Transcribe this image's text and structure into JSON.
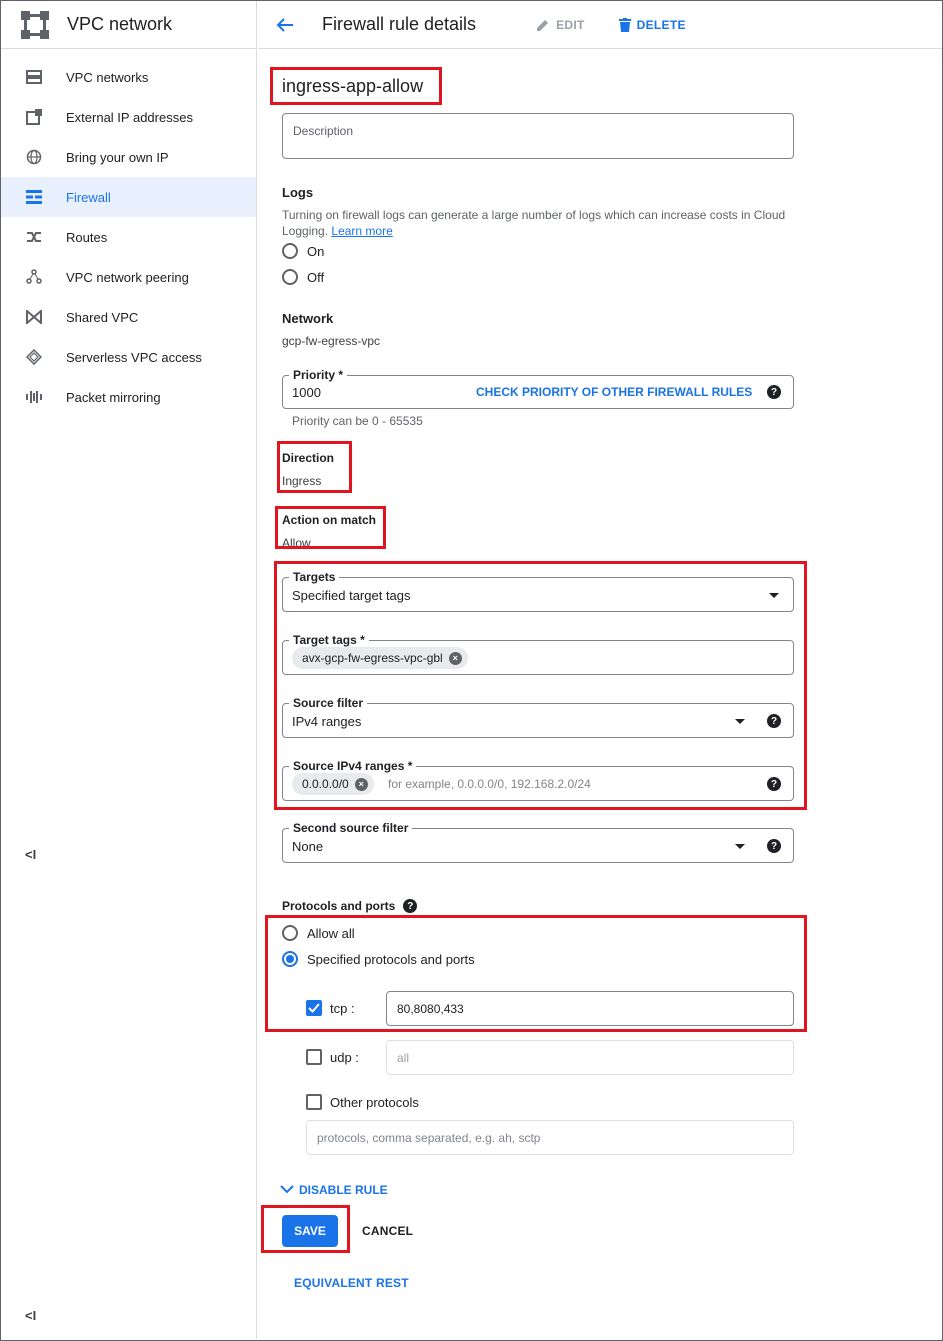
{
  "sidebar": {
    "title": "VPC network",
    "items": [
      {
        "label": "VPC networks",
        "icon": "vpc-networks-icon"
      },
      {
        "label": "External IP addresses",
        "icon": "external-ip-icon"
      },
      {
        "label": "Bring your own IP",
        "icon": "globe-icon"
      },
      {
        "label": "Firewall",
        "icon": "firewall-icon",
        "active": true
      },
      {
        "label": "Routes",
        "icon": "routes-icon"
      },
      {
        "label": "VPC network peering",
        "icon": "peering-icon"
      },
      {
        "label": "Shared VPC",
        "icon": "shared-vpc-icon"
      },
      {
        "label": "Serverless VPC access",
        "icon": "serverless-icon"
      },
      {
        "label": "Packet mirroring",
        "icon": "packet-mirroring-icon"
      }
    ],
    "collapse_label": "<I"
  },
  "header": {
    "title": "Firewall rule details",
    "edit_label": "EDIT",
    "delete_label": "DELETE"
  },
  "rule": {
    "name": "ingress-app-allow",
    "description_placeholder": "Description"
  },
  "logs": {
    "heading": "Logs",
    "help_text": "Turning on firewall logs can generate a large number of logs which can increase costs in Cloud Logging.",
    "learn_more": "Learn more",
    "on_label": "On",
    "off_label": "Off"
  },
  "network": {
    "heading": "Network",
    "value": "gcp-fw-egress-vpc"
  },
  "priority": {
    "label": "Priority *",
    "value": "1000",
    "check_link": "CHECK PRIORITY OF OTHER FIREWALL RULES",
    "hint": "Priority can be 0 - 65535"
  },
  "direction": {
    "heading": "Direction",
    "value": "Ingress"
  },
  "action": {
    "heading": "Action on match",
    "value": "Allow"
  },
  "targets": {
    "label": "Targets",
    "value": "Specified target tags"
  },
  "target_tags": {
    "label": "Target tags *",
    "chip": "avx-gcp-fw-egress-vpc-gbl"
  },
  "source_filter": {
    "label": "Source filter",
    "value": "IPv4 ranges"
  },
  "source_ranges": {
    "label": "Source IPv4 ranges *",
    "chip": "0.0.0.0/0",
    "placeholder": "for example, 0.0.0.0/0, 192.168.2.0/24"
  },
  "second_source_filter": {
    "label": "Second source filter",
    "value": "None"
  },
  "protocols": {
    "heading": "Protocols and ports",
    "allow_all": "Allow all",
    "specified": "Specified protocols and ports",
    "tcp_label": "tcp :",
    "tcp_value": "80,8080,433",
    "udp_label": "udp :",
    "udp_placeholder": "all",
    "other_label": "Other protocols",
    "other_placeholder": "protocols, comma separated, e.g. ah, sctp"
  },
  "footer": {
    "disable_rule": "DISABLE RULE",
    "save": "SAVE",
    "cancel": "CANCEL",
    "equivalent_rest": "EQUIVALENT REST"
  },
  "colors": {
    "accent": "#1a73e8",
    "highlight": "#e0151f"
  }
}
